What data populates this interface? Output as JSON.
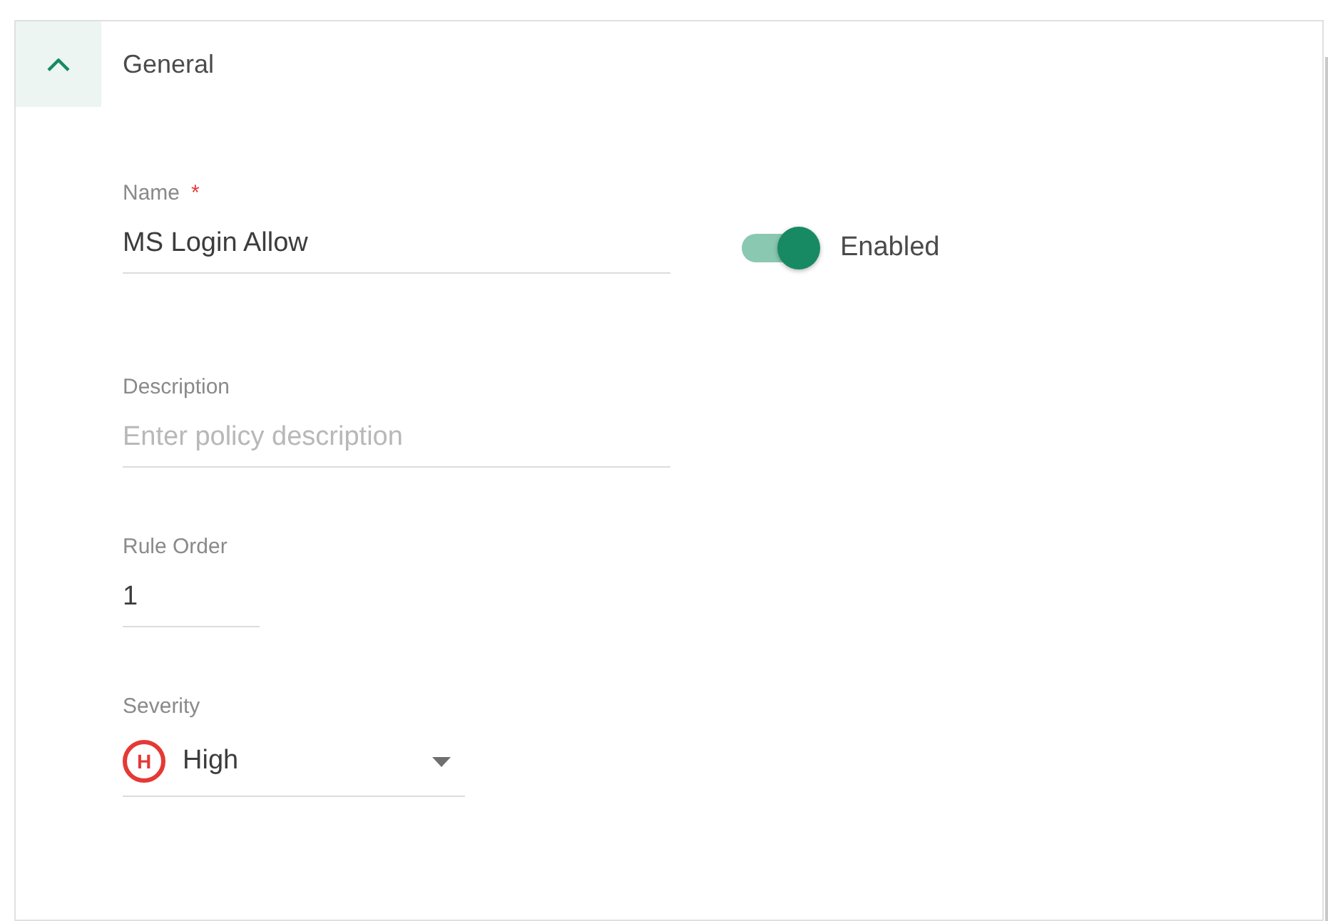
{
  "section": {
    "title": "General",
    "expanded": true,
    "toggle": {
      "label": "Enabled",
      "on": true
    },
    "fields": [
      {
        "kind": "text",
        "label": "Name",
        "required_mark": "*",
        "value": "MS Login Allow"
      },
      {
        "kind": "text",
        "label": "Description",
        "placeholder": "Enter policy description"
      },
      {
        "kind": "number",
        "label": "Rule Order",
        "value": "1"
      },
      {
        "kind": "select",
        "label": "Severity",
        "badge": "H",
        "value": "High"
      }
    ]
  }
}
